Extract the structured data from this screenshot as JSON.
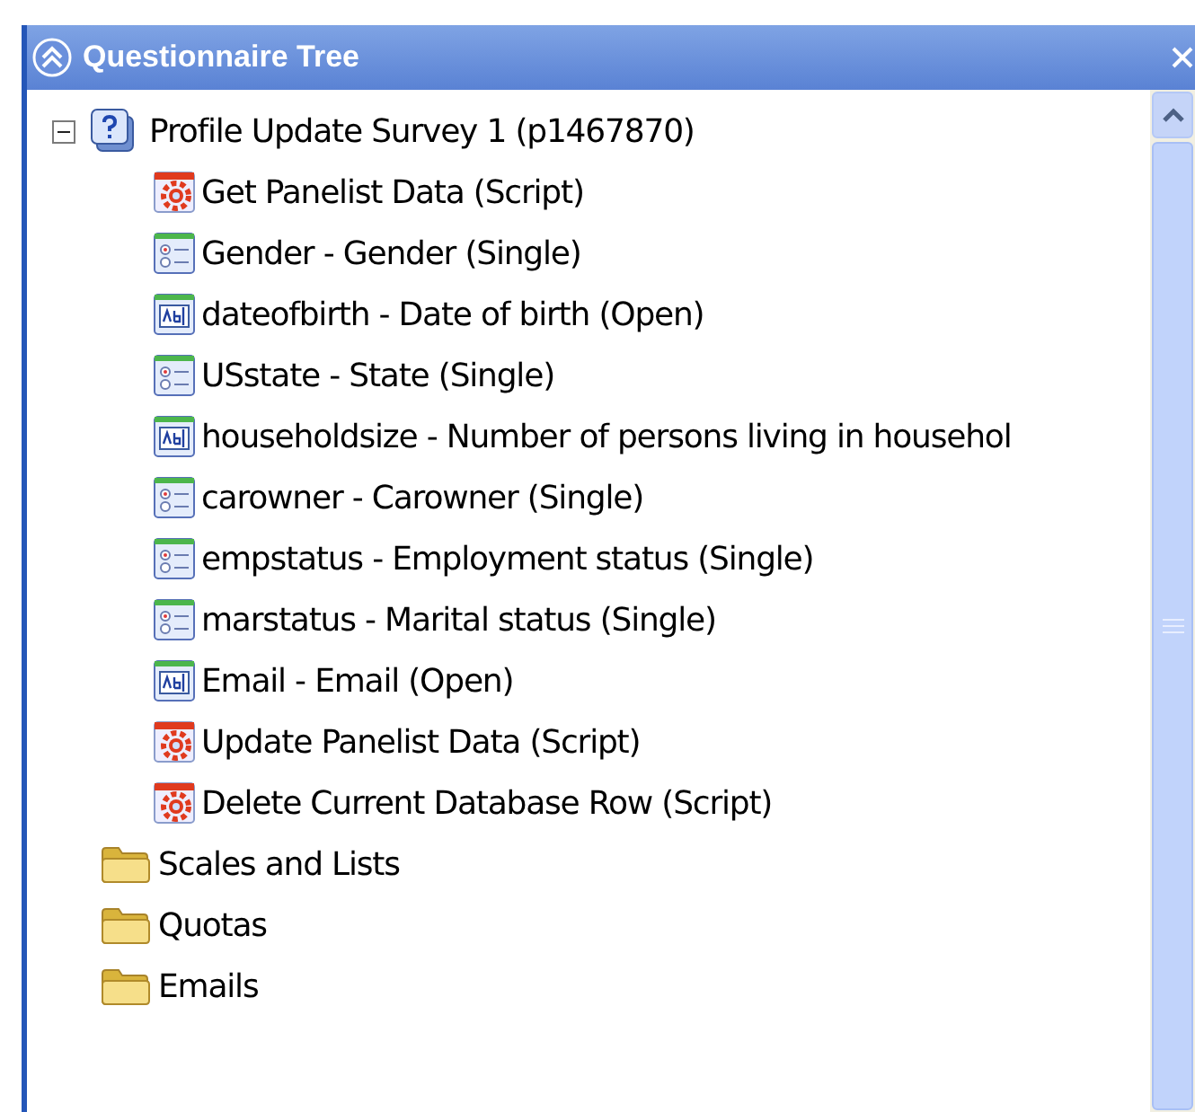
{
  "panel": {
    "title": "Questionnaire Tree"
  },
  "tree": [
    {
      "label": "Profile Update Survey 1 (p1467870)",
      "kind": "survey",
      "expanded": true,
      "children": [
        {
          "label": "Get Panelist Data (Script)",
          "kind": "script"
        },
        {
          "label": "Gender - Gender (Single)",
          "kind": "single"
        },
        {
          "label": "dateofbirth - Date of birth (Open)",
          "kind": "open"
        },
        {
          "label": "USstate - State (Single)",
          "kind": "single"
        },
        {
          "label": "householdsize - Number of persons living in househol",
          "kind": "open"
        },
        {
          "label": "carowner - Carowner (Single)",
          "kind": "single"
        },
        {
          "label": "empstatus - Employment status (Single)",
          "kind": "single"
        },
        {
          "label": "marstatus - Marital status (Single)",
          "kind": "single"
        },
        {
          "label": "Email - Email (Open)",
          "kind": "open"
        },
        {
          "label": "Update Panelist Data (Script)",
          "kind": "script"
        },
        {
          "label": "Delete Current Database Row (Script)",
          "kind": "script"
        }
      ]
    },
    {
      "label": "Scales and Lists",
      "kind": "folder"
    },
    {
      "label": "Quotas",
      "kind": "folder"
    },
    {
      "label": "Emails",
      "kind": "folder"
    }
  ]
}
